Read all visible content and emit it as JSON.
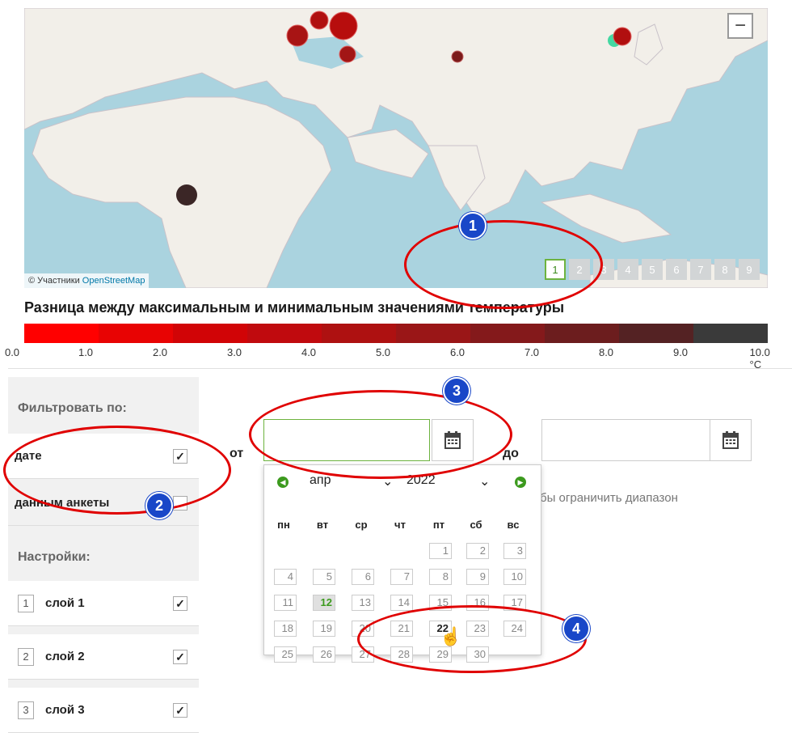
{
  "map": {
    "attribution_prefix": "© Участники",
    "attribution_link": "OpenStreetMap",
    "zoom_out": "−",
    "layer_buttons": [
      "1",
      "2",
      "3",
      "4",
      "5",
      "6",
      "7",
      "8",
      "9"
    ],
    "active_layer": "1"
  },
  "legend": {
    "title": "Разница между максимальным и минимальным значениями температуры",
    "colors": [
      "#ff0000",
      "#e80303",
      "#d10406",
      "#c00a0e",
      "#ae1111",
      "#9a1617",
      "#84191b",
      "#6c1d1e",
      "#542223",
      "#3a3a3a"
    ],
    "ticks": [
      "0.0",
      "1.0",
      "2.0",
      "3.0",
      "4.0",
      "5.0",
      "6.0",
      "7.0",
      "8.0",
      "9.0",
      "10.0 °C"
    ]
  },
  "sidebar": {
    "filter_heading": "Фильтровать по:",
    "filter_items": [
      {
        "label": "дате",
        "checked": true
      },
      {
        "label": "данным анкеты",
        "checked": false
      }
    ],
    "settings_heading": "Настройки:",
    "layers": [
      {
        "num": "1",
        "label": "слой 1",
        "check": "✓"
      },
      {
        "num": "2",
        "label": "слой 2",
        "check": "✓"
      },
      {
        "num": "3",
        "label": "слой 3",
        "check": "✓"
      }
    ],
    "check_mark": "✓"
  },
  "date_filter": {
    "from_label": "от",
    "to_label": "до",
    "from_value": "",
    "to_value": "",
    "hint": "бы ограничить диапазон"
  },
  "datepicker": {
    "month": "апр",
    "year": "2022",
    "weekdays": [
      "пн",
      "вт",
      "ср",
      "чт",
      "пт",
      "сб",
      "вс"
    ],
    "weeks": [
      [
        "",
        "",
        "",
        "",
        "1",
        "2",
        "3"
      ],
      [
        "4",
        "5",
        "6",
        "7",
        "8",
        "9",
        "10"
      ],
      [
        "11",
        "12",
        "13",
        "14",
        "15",
        "16",
        "17"
      ],
      [
        "18",
        "19",
        "20",
        "21",
        "22",
        "23",
        "24"
      ],
      [
        "25",
        "26",
        "27",
        "28",
        "29",
        "30",
        ""
      ]
    ],
    "today": "12",
    "hover": "22"
  },
  "annotations": [
    "1",
    "2",
    "3",
    "4"
  ]
}
